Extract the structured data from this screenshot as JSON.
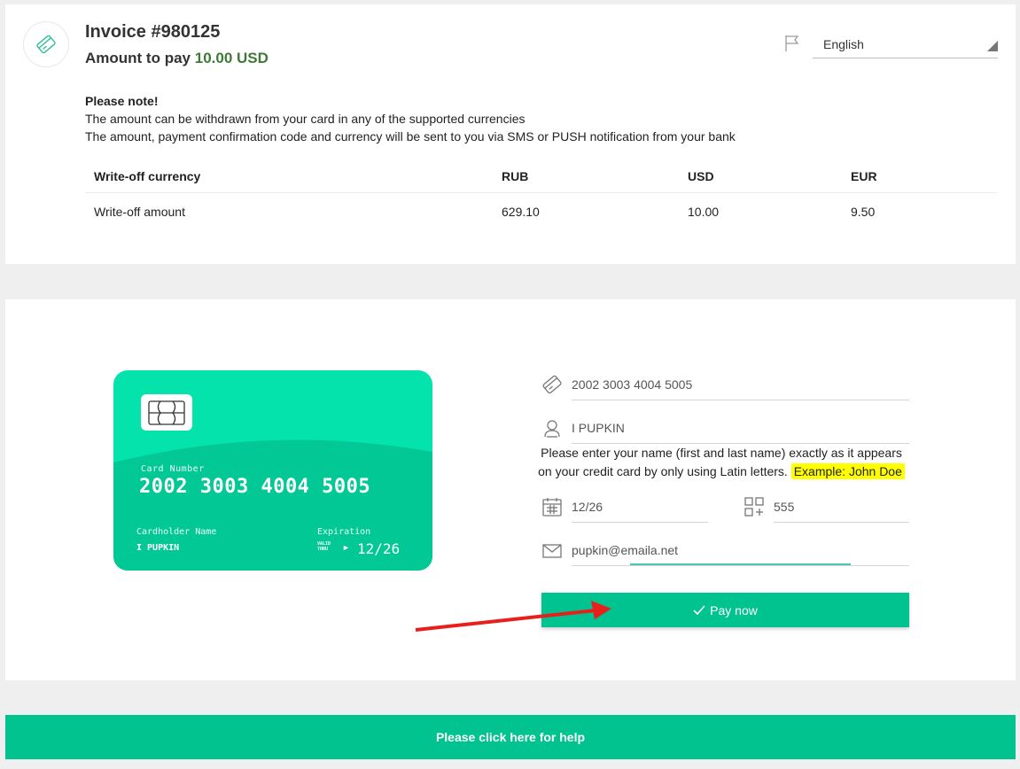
{
  "invoice": {
    "title": "Invoice #980125",
    "amount_label": "Amount to pay",
    "amount_value": "10.00 USD"
  },
  "language": {
    "selected": "English",
    "icon": "flag-icon"
  },
  "note": {
    "title": "Please note!",
    "line1": "The amount can be withdrawn from your card in any of the supported currencies",
    "line2": "The amount, payment confirmation code and currency will be sent to you via SMS or PUSH notification from your bank"
  },
  "currency_table": {
    "headers": [
      "Write-off currency",
      "RUB",
      "USD",
      "EUR"
    ],
    "row": [
      "Write-off amount",
      "629.10",
      "10.00",
      "9.50"
    ]
  },
  "card_preview": {
    "number_label": "Card Number",
    "number": "2002 3003 4004 5005",
    "holder_label": "Cardholder Name",
    "holder": "I PUPKIN",
    "expiration_label": "Expiration",
    "valid_thru": "VALID THRU",
    "expiry": "12/26",
    "colors": {
      "top": "#05e3ad",
      "bottom": "#02c896"
    }
  },
  "form": {
    "card_number": "2002 3003 4004 5005",
    "name": "I PUPKIN",
    "name_hint": "Please enter your name (first and last name) exactly as it appears on your credit card by only using Latin letters.",
    "name_example": "Example: John Doe",
    "expiry": "12/26",
    "cvv": "555",
    "email": "pupkin@emaila.net",
    "pay_label": "Pay now"
  },
  "help": {
    "label": "Please click here for help"
  },
  "colors": {
    "accent": "#01c38f",
    "amount": "#3d7a36",
    "highlight": "#ffff00",
    "annotation_arrow": "#e8201b"
  }
}
